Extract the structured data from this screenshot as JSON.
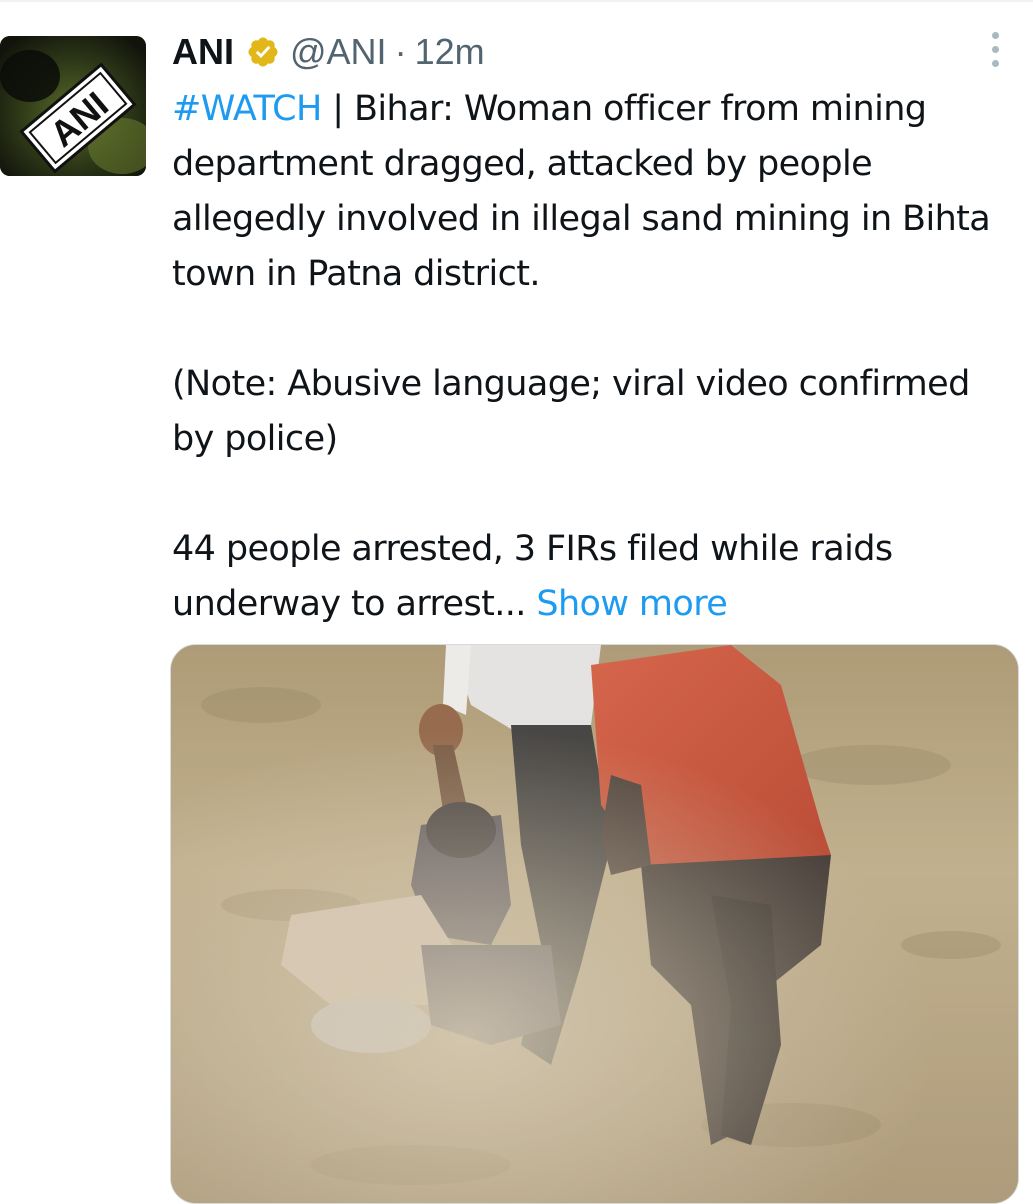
{
  "author": {
    "display_name": "ANI",
    "handle": "@ANI",
    "separator": "·",
    "time": "12m",
    "verified_badge_color": "#e2b719",
    "avatar_logo_text": "ANI"
  },
  "tweet": {
    "hashtag": "#WATCH",
    "line1_rest": " | Bihar: Woman officer from mining department dragged, attacked by people allegedly involved in illegal sand mining in Bihta town in Patna district.",
    "note": "(Note: Abusive language; viral video confirmed by police)",
    "para3": "44 people arrested, 3 FIRs filed while raids underway to arrest... ",
    "show_more": "Show more"
  },
  "icons": {
    "verified": "verified-badge-icon",
    "more": "more-vertical-icon"
  },
  "colors": {
    "link": "#1d9bf0",
    "secondary_text": "#536471",
    "primary_text": "#0f1419"
  }
}
